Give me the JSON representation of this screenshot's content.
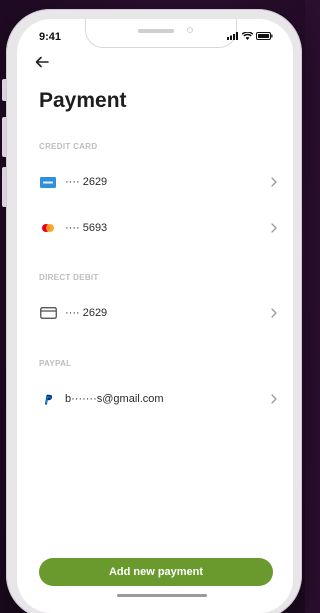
{
  "status_bar": {
    "time": "9:41"
  },
  "header": {
    "back_icon": "arrow-left-icon",
    "title": "Payment"
  },
  "sections": {
    "credit_card": {
      "title": "CREDIT CARD",
      "items": [
        {
          "icon": "amex-card-icon",
          "label": "···· 2629"
        },
        {
          "icon": "mastercard-icon",
          "label": "···· 5693"
        }
      ]
    },
    "direct_debit": {
      "title": "DIRECT DEBIT",
      "items": [
        {
          "icon": "bank-card-icon",
          "label": "···· 2629"
        }
      ]
    },
    "paypal": {
      "title": "PAYPAL",
      "items": [
        {
          "icon": "paypal-icon",
          "label": "b·······s@gmail.com"
        }
      ]
    }
  },
  "footer": {
    "add_button_label": "Add new payment"
  },
  "colors": {
    "accent": "#6a9a2e",
    "section_header": "#bdbdbd",
    "amex": "#2f8fdb",
    "mastercard_red": "#eb001b",
    "mastercard_orange": "#f79e1b",
    "paypal": "#003087"
  }
}
